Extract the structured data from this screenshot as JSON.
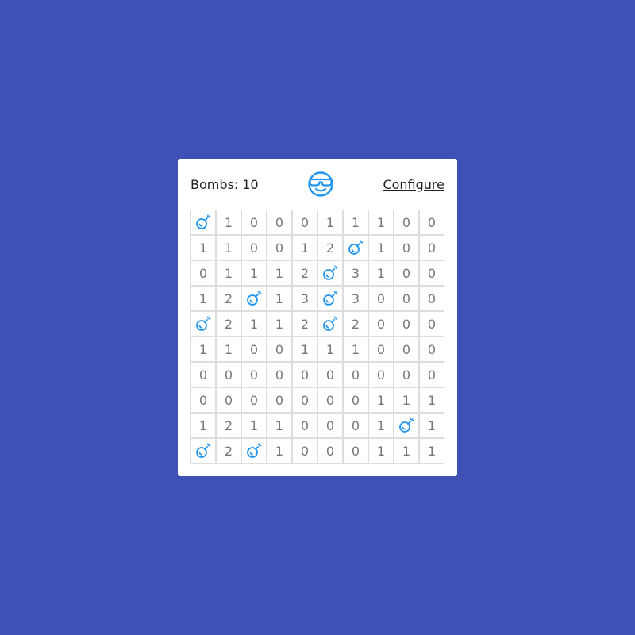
{
  "header": {
    "bombs_label": "Bombs:",
    "bombs_count": "10",
    "face_icon": "sunglasses-face-icon",
    "configure_label": "Configure"
  },
  "colors": {
    "background": "#3f51b5",
    "accent": "#2196f3",
    "number": "#777777"
  },
  "board": {
    "rows": 10,
    "cols": 10,
    "bomb_icon": "bomb-icon",
    "cells": [
      [
        "B",
        "1",
        "0",
        "0",
        "0",
        "1",
        "1",
        "1",
        "0",
        "0"
      ],
      [
        "1",
        "1",
        "0",
        "0",
        "1",
        "2",
        "B",
        "1",
        "0",
        "0"
      ],
      [
        "0",
        "1",
        "1",
        "1",
        "2",
        "B",
        "3",
        "1",
        "0",
        "0"
      ],
      [
        "1",
        "2",
        "B",
        "1",
        "3",
        "B",
        "3",
        "0",
        "0",
        "0"
      ],
      [
        "B",
        "2",
        "1",
        "1",
        "2",
        "B",
        "2",
        "0",
        "0",
        "0"
      ],
      [
        "1",
        "1",
        "0",
        "0",
        "1",
        "1",
        "1",
        "0",
        "0",
        "0"
      ],
      [
        "0",
        "0",
        "0",
        "0",
        "0",
        "0",
        "0",
        "0",
        "0",
        "0"
      ],
      [
        "0",
        "0",
        "0",
        "0",
        "0",
        "0",
        "0",
        "1",
        "1",
        "1"
      ],
      [
        "1",
        "2",
        "1",
        "1",
        "0",
        "0",
        "0",
        "1",
        "B",
        "1"
      ],
      [
        "B",
        "2",
        "B",
        "1",
        "0",
        "0",
        "0",
        "1",
        "1",
        "1"
      ]
    ]
  }
}
